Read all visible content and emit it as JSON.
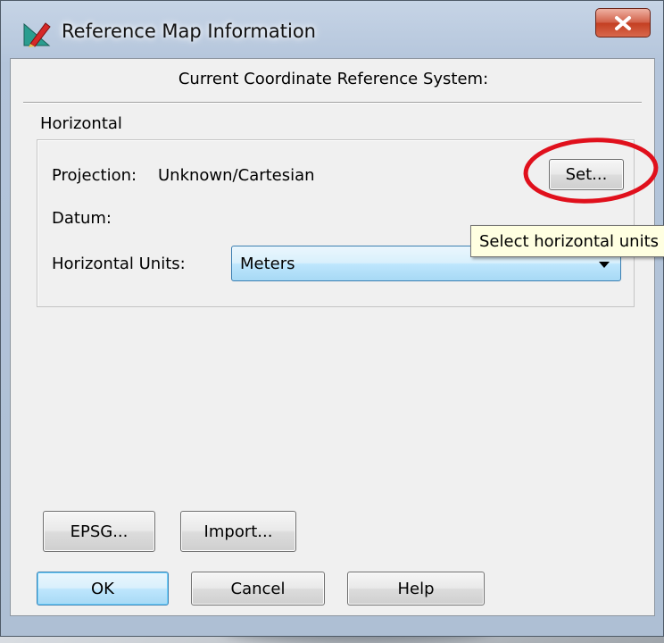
{
  "window": {
    "title": "Reference Map Information",
    "icon": "pencil-ruler-icon",
    "close_icon": "close-icon",
    "close_label": "X"
  },
  "dialog": {
    "heading": "Current Coordinate Reference System:",
    "group_label": "Horizontal",
    "projection": {
      "label": "Projection:",
      "value": "Unknown/Cartesian",
      "set_button": "Set..."
    },
    "datum": {
      "label": "Datum:",
      "value": ""
    },
    "horizontal_units": {
      "label": "Horizontal Units:",
      "selected": "Meters",
      "dropdown_icon": "chevron-down-icon",
      "tooltip": "Select horizontal units"
    },
    "epsg_button": "EPSG...",
    "import_button": "Import...",
    "ok_button": "OK",
    "cancel_button": "Cancel",
    "help_button": "Help"
  },
  "annotation": {
    "highlight_color": "#e0101c"
  },
  "colors": {
    "close_button": "#c43f22",
    "focus_accent": "#3c7fb1",
    "dialog_bg": "#f0f0f0",
    "tooltip_bg": "#ffffe1"
  }
}
